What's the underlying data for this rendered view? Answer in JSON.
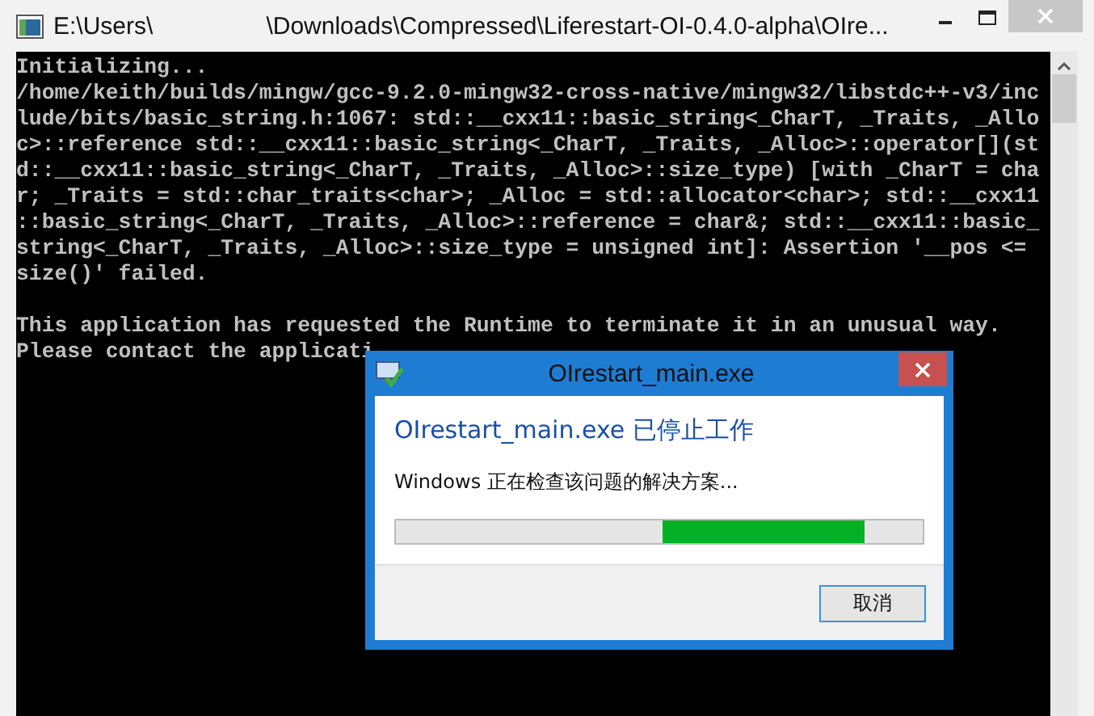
{
  "console_window": {
    "title_parts": [
      "E:\\Users\\",
      "\\Downloads\\Compressed\\Liferestart-OI-0.4.0-alpha\\OIre..."
    ],
    "output_blocks": [
      [
        "Initializing...",
        "/home/keith/builds/mingw/gcc-9.2.0-mingw32-cross-native/mingw32/libstdc++-v3/inc",
        "lude/bits/basic_string.h:1067: std::__cxx11::basic_string<_CharT, _Traits, _Allo",
        "c>::reference std::__cxx11::basic_string<_CharT, _Traits, _Alloc>::operator[](st",
        "d::__cxx11::basic_string<_CharT, _Traits, _Alloc>::size_type) [with _CharT = cha",
        "r; _Traits = std::char_traits<char>; _Alloc = std::allocator<char>; std::__cxx11",
        "::basic_string<_CharT, _Traits, _Alloc>::reference = char&; std::__cxx11::basic_",
        "string<_CharT, _Traits, _Alloc>::size_type = unsigned int]: Assertion '__pos <=",
        "size()' failed."
      ],
      [
        "This application has requested the Runtime to terminate it in an unusual way.",
        "Please contact the applicati"
      ]
    ]
  },
  "error_dialog": {
    "title": "OIrestart_main.exe",
    "heading": "OIrestart_main.exe 已停止工作",
    "status": "Windows 正在检查该问题的解决方案...",
    "buttons": [
      "取消"
    ]
  }
}
